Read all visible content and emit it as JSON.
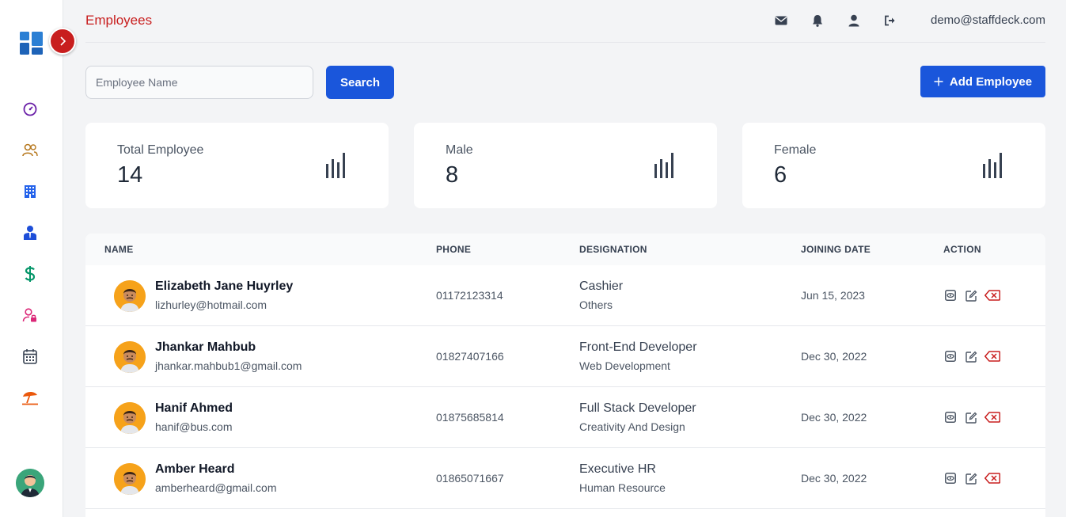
{
  "header": {
    "title": "Employees",
    "user_email": "demo@staffdeck.com",
    "icons": [
      "mail-icon",
      "bell-icon",
      "user-icon",
      "logout-icon"
    ]
  },
  "sidebar": {
    "items": [
      {
        "icon": "dashboard-icon",
        "color": "#6b21a8"
      },
      {
        "icon": "users-icon",
        "color": "#b7791f"
      },
      {
        "icon": "building-icon",
        "color": "#2563eb"
      },
      {
        "icon": "employee-badge-icon",
        "color": "#1d4ed8"
      },
      {
        "icon": "dollar-icon",
        "color": "#059669"
      },
      {
        "icon": "user-lock-icon",
        "color": "#db2777"
      },
      {
        "icon": "calendar-icon",
        "color": "#374151"
      },
      {
        "icon": "beach-umbrella-icon",
        "color": "#ea580c"
      }
    ]
  },
  "search": {
    "placeholder": "Employee Name",
    "value": "",
    "button_label": "Search"
  },
  "add_button": {
    "label": "Add Employee"
  },
  "stats": [
    {
      "label": "Total Employee",
      "value": "14"
    },
    {
      "label": "Male",
      "value": "8"
    },
    {
      "label": "Female",
      "value": "6"
    }
  ],
  "table": {
    "columns": [
      "NAME",
      "PHONE",
      "DESIGNATION",
      "JOINING DATE",
      "ACTION"
    ],
    "rows": [
      {
        "name": "Elizabeth Jane Huyrley",
        "email": "lizhurley@hotmail.com",
        "phone": "01172123314",
        "designation": "Cashier",
        "department": "Others",
        "joining_date": "Jun 15, 2023"
      },
      {
        "name": "Jhankar Mahbub",
        "email": "jhankar.mahbub1@gmail.com",
        "phone": "01827407166",
        "designation": "Front-End Developer",
        "department": "Web Development",
        "joining_date": "Dec 30, 2022"
      },
      {
        "name": "Hanif Ahmed",
        "email": "hanif@bus.com",
        "phone": "01875685814",
        "designation": "Full Stack Developer",
        "department": "Creativity And Design",
        "joining_date": "Dec 30, 2022"
      },
      {
        "name": "Amber Heard",
        "email": "amberheard@gmail.com",
        "phone": "01865071667",
        "designation": "Executive HR",
        "department": "Human Resource",
        "joining_date": "Dec 30, 2022"
      }
    ]
  },
  "colors": {
    "accent": "#1a56db",
    "danger": "#c81e1e"
  }
}
